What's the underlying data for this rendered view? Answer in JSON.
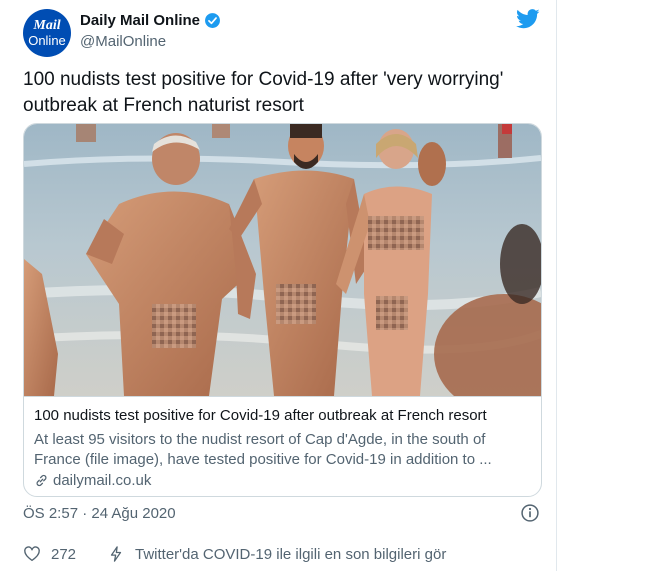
{
  "author": {
    "avatar_line1": "Mail",
    "avatar_line2": "Online",
    "name": "Daily Mail Online",
    "handle": "@MailOnline"
  },
  "tweet_text": "100 nudists test positive for Covid-19 after 'very worrying' outbreak at French naturist resort",
  "card": {
    "title": "100 nudists test positive for Covid-19 after outbreak at French resort",
    "description": "At least 95 visitors to the nudist resort of Cap d'Agde, in the south of France (file image), have tested positive for Covid-19 in addition to ...",
    "domain": "dailymail.co.uk"
  },
  "timestamp": "ÖS 2:57 · 24 Ağu 2020",
  "actions": {
    "like_count": "272",
    "covid_info": "Twitter'da COVID-19 ile ilgili en son bilgileri gör"
  },
  "colors": {
    "brand_twitter": "#1d9bf0",
    "avatar_bg": "#004db3",
    "secondary_text": "#536471",
    "border": "#cfd9de"
  },
  "icons": [
    "verified-icon",
    "twitter-bird-icon",
    "link-icon",
    "info-icon",
    "heart-icon",
    "covid-bolt-icon"
  ]
}
